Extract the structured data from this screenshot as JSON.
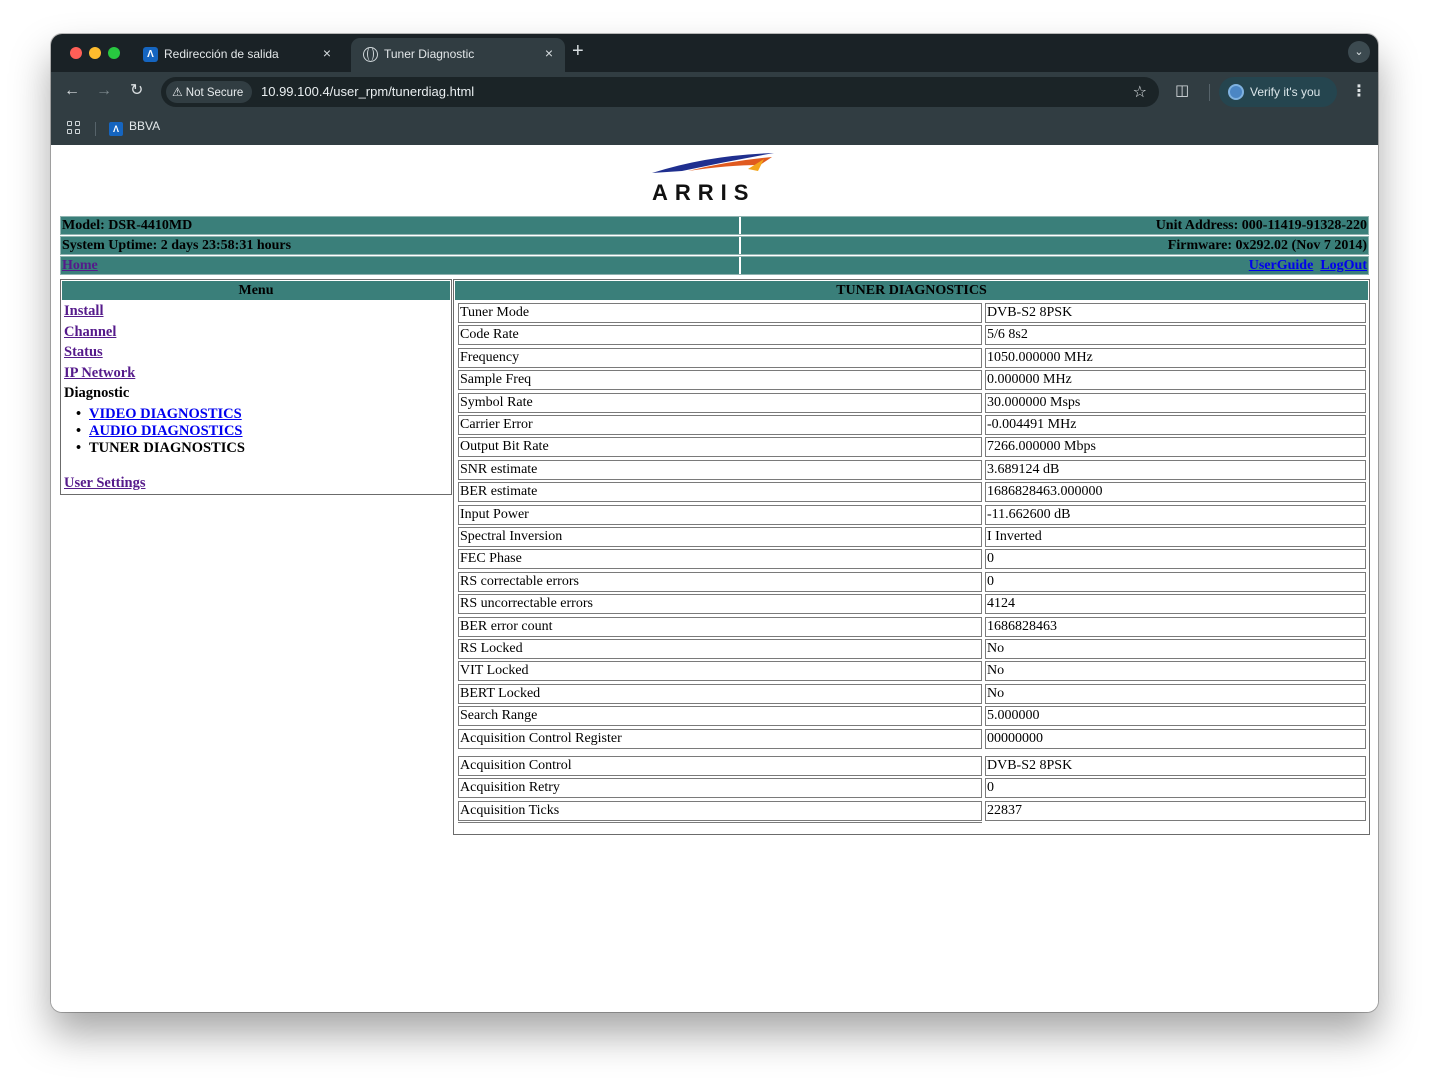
{
  "browser": {
    "tabs": [
      {
        "title": "Redirección de salida",
        "favicon": "bbva-logo-icon",
        "active": false
      },
      {
        "title": "Tuner Diagnostic",
        "favicon": "globe-icon",
        "active": true
      }
    ],
    "new_tab_symbol": "+",
    "close_symbol": "×",
    "security_label": "Not Secure",
    "url": "10.99.100.4/user_rpm/tunerdiag.html",
    "profile_label": "Verify it's you",
    "bookmarks": [
      {
        "label": "BBVA",
        "icon": "bbva-logo-icon"
      }
    ]
  },
  "page": {
    "logo_text": "ARRIS",
    "header": {
      "model": "Model: DSR-4410MD",
      "unit_address": "Unit Address: 000-11419-91328-220",
      "uptime": "System Uptime: 2 days 23:58:31 hours",
      "firmware": "Firmware: 0x292.02 (Nov 7 2014)",
      "home_link": "Home",
      "userguide_link": "UserGuide",
      "logout_link": "LogOut"
    },
    "menu": {
      "title": "Menu",
      "links": [
        "Install",
        "Channel",
        "Status",
        "IP Network"
      ],
      "diagnostic_label": "Diagnostic",
      "diagnostic_items": [
        "VIDEO DIAGNOSTICS",
        "AUDIO DIAGNOSTICS",
        "TUNER DIAGNOSTICS"
      ],
      "user_settings": "User Settings"
    },
    "diagnostics": {
      "title": "TUNER DIAGNOSTICS",
      "rows": [
        {
          "name": "Tuner Mode",
          "value": "DVB-S2 8PSK"
        },
        {
          "name": "Code Rate",
          "value": "5/6 8s2"
        },
        {
          "name": "Frequency",
          "value": "1050.000000 MHz"
        },
        {
          "name": "Sample Freq",
          "value": "0.000000 MHz"
        },
        {
          "name": "Symbol Rate",
          "value": "30.000000 Msps"
        },
        {
          "name": "Carrier Error",
          "value": "-0.004491 MHz"
        },
        {
          "name": "Output Bit Rate",
          "value": "7266.000000 Mbps"
        },
        {
          "name": "SNR estimate",
          "value": "3.689124 dB"
        },
        {
          "name": "BER estimate",
          "value": "1686828463.000000"
        },
        {
          "name": "Input Power",
          "value": "-11.662600 dB"
        },
        {
          "name": "Spectral Inversion",
          "value": "I Inverted"
        },
        {
          "name": "FEC Phase",
          "value": "0"
        },
        {
          "name": "RS correctable errors",
          "value": "0"
        },
        {
          "name": "RS uncorrectable errors",
          "value": "4124"
        },
        {
          "name": "BER error count",
          "value": "1686828463"
        },
        {
          "name": "RS Locked",
          "value": "No"
        },
        {
          "name": "VIT Locked",
          "value": "No"
        },
        {
          "name": "BERT Locked",
          "value": "No"
        },
        {
          "name": "Search Range",
          "value": "5.000000"
        },
        {
          "name": "Acquisition Control Register",
          "value": "00000000"
        },
        {
          "name": "Acquisition Control",
          "value": "DVB-S2 8PSK"
        },
        {
          "name": "Acquisition Retry",
          "value": "0"
        },
        {
          "name": "Acquisition Ticks",
          "value": "22837"
        }
      ]
    }
  },
  "colors": {
    "header_teal": "#3a7f7a",
    "visited_link": "#551a8b",
    "unvisited_link": "#0000ee",
    "browser_dark": "#1a2226",
    "browser_toolbar": "#313d42"
  }
}
